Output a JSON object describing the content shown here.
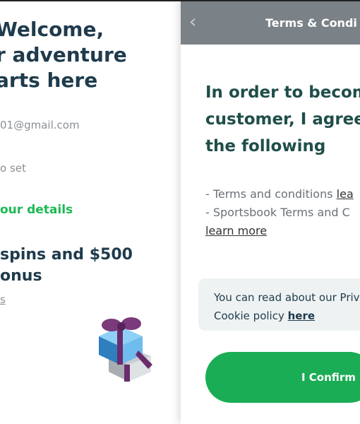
{
  "left": {
    "welcome_lines": [
      "Welcome,",
      "r adventure",
      "arts here"
    ],
    "email": "01@gmail.com",
    "password_status": "o set",
    "details_link": "our details",
    "offer_lines": [
      "spins and $500",
      "onus"
    ],
    "terms_link": "s"
  },
  "modal": {
    "title": "Terms & Condi",
    "heading_lines": [
      "In order to becom",
      "customer, I agree",
      "the following"
    ],
    "terms": {
      "line1_prefix": "- Terms and conditions ",
      "line1_link": "lea",
      "line2": "- Sportsbook Terms and C",
      "line3_link": "learn more"
    },
    "notice": {
      "line1": "You can read about our Priv",
      "line2_prefix": "Cookie policy ",
      "line2_link": "here"
    },
    "confirm_label": "I Confirm"
  },
  "colors": {
    "header_bg": "#7b8287",
    "accent_green": "#1aad55",
    "heading_teal": "#1f4e4a",
    "notice_bg": "#eef2f2"
  },
  "icons": {
    "back": "chevron-left-icon",
    "gift": "gift-box-icon"
  }
}
